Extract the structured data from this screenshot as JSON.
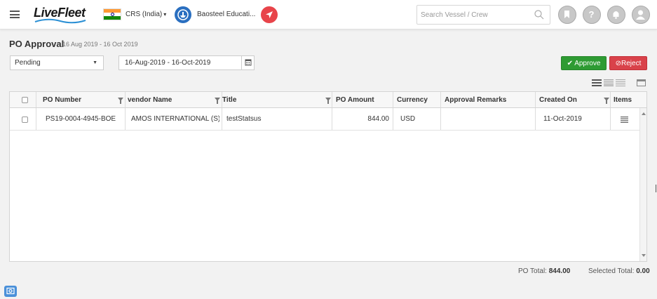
{
  "header": {
    "logo_text": "LiveFleet",
    "company": "CRS (India)",
    "vessel": "Baosteel Educati...",
    "search_placeholder": "Search Vessel / Crew"
  },
  "page": {
    "title": "PO Approval",
    "subtitle": "16 Aug 2019 - 16 Oct 2019"
  },
  "filters": {
    "status": "Pending",
    "date_range": "16-Aug-2019 - 16-Oct-2019"
  },
  "actions": {
    "approve_label": "Approve",
    "reject_label": "Reject"
  },
  "table": {
    "columns": [
      "PO Number",
      "vendor Name",
      "Title",
      "PO Amount",
      "Currency",
      "Approval Remarks",
      "Created On",
      "Items"
    ],
    "rows": [
      {
        "po_number": "PS19-0004-4945-BOE",
        "vendor": "AMOS INTERNATIONAL (S)...",
        "title": "testStatsus",
        "amount": "844.00",
        "currency": "USD",
        "remarks": "",
        "created_on": "11-Oct-2019"
      }
    ]
  },
  "totals": {
    "po_total_label": "PO Total:",
    "po_total_value": "844.00",
    "selected_total_label": "Selected Total:",
    "selected_total_value": "0.00"
  },
  "colors": {
    "approve": "#2e9b33",
    "reject": "#d9424a",
    "vessel_icon": "#2a6fc0",
    "nav_icon": "#e8444a"
  },
  "icons": [
    "hamburger-icon",
    "india-flag-icon",
    "vessel-icon",
    "navigation-icon",
    "search-icon",
    "bookmark-icon",
    "help-icon",
    "bell-icon",
    "user-icon",
    "calendar-icon",
    "filter-icon",
    "list-icon",
    "feedback-icon"
  ]
}
